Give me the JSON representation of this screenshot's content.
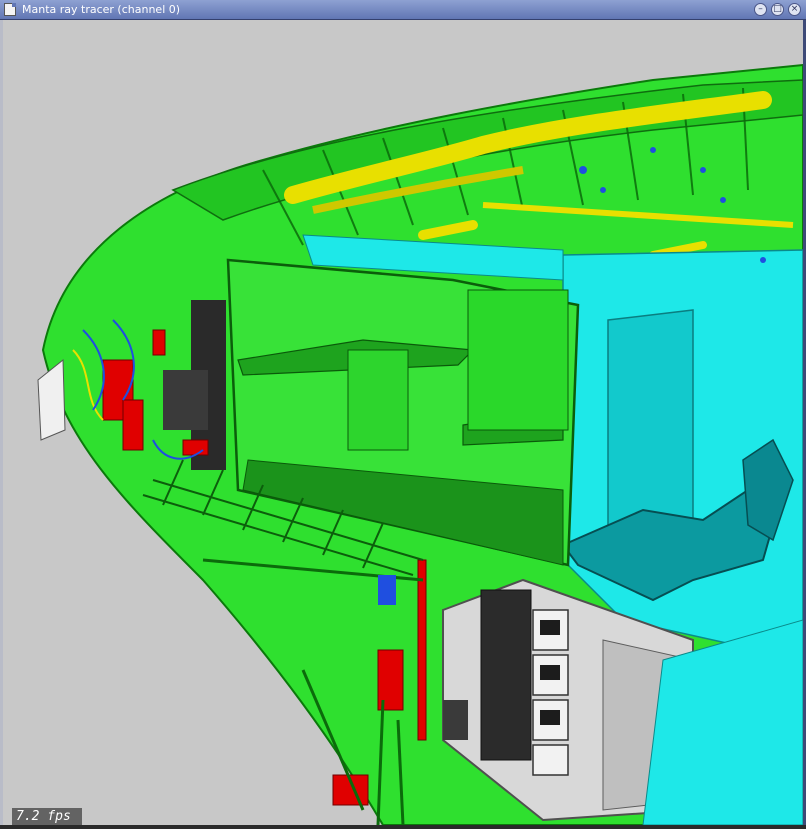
{
  "window": {
    "title": "Manta ray tracer (channel 0)",
    "icons": [
      "window-icon",
      "minimize-icon",
      "maximize-icon",
      "close-icon"
    ]
  },
  "viewport": {
    "fps_label": "7.2 fps",
    "description_colors": {
      "background": "#c8c8c8",
      "hull": "#2fe02f",
      "ducts": "#e8e000",
      "cyan_panels": "#1ee8e8",
      "red_parts": "#e00000",
      "equipment": "#d0d0d0"
    }
  }
}
